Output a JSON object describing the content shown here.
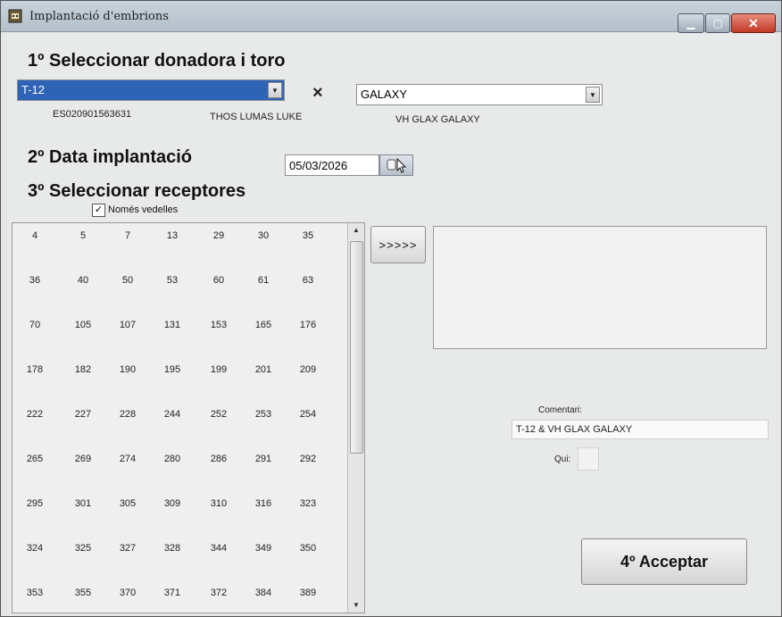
{
  "window": {
    "title": "Implantació d'embrions"
  },
  "step1": {
    "heading": "1º Seleccionar donadora i toro",
    "donor": {
      "value": "T-12",
      "code": "ES020901563631",
      "sire_name": "THOS LUMAS LUKE"
    },
    "times_symbol": "×",
    "bull": {
      "value": "GALAXY",
      "full_name": "VH GLAX GALAXY"
    }
  },
  "step2": {
    "heading": "2º Data implantació",
    "date_value": "05/03/2026"
  },
  "step3": {
    "heading": "3º Seleccionar receptores",
    "filter_checkbox": {
      "label": "Només vedelles",
      "checked": true
    },
    "receptors": [
      [
        "4",
        "5",
        "7",
        "13",
        "29",
        "30",
        "35"
      ],
      [
        "36",
        "40",
        "50",
        "53",
        "60",
        "61",
        "63"
      ],
      [
        "70",
        "105",
        "107",
        "131",
        "153",
        "165",
        "176"
      ],
      [
        "178",
        "182",
        "190",
        "195",
        "199",
        "201",
        "209"
      ],
      [
        "222",
        "227",
        "228",
        "244",
        "252",
        "253",
        "254"
      ],
      [
        "265",
        "269",
        "274",
        "280",
        "286",
        "291",
        "292"
      ],
      [
        "295",
        "301",
        "305",
        "309",
        "310",
        "316",
        "323"
      ],
      [
        "324",
        "325",
        "327",
        "328",
        "344",
        "349",
        "350"
      ],
      [
        "353",
        "355",
        "370",
        "371",
        "372",
        "384",
        "389"
      ]
    ],
    "move_button": ">>>>>"
  },
  "comment": {
    "label": "Comentari:",
    "value": "T-12 &  VH GLAX GALAXY"
  },
  "who": {
    "label": "Qui:",
    "value": ""
  },
  "accept_button": "4º Acceptar"
}
